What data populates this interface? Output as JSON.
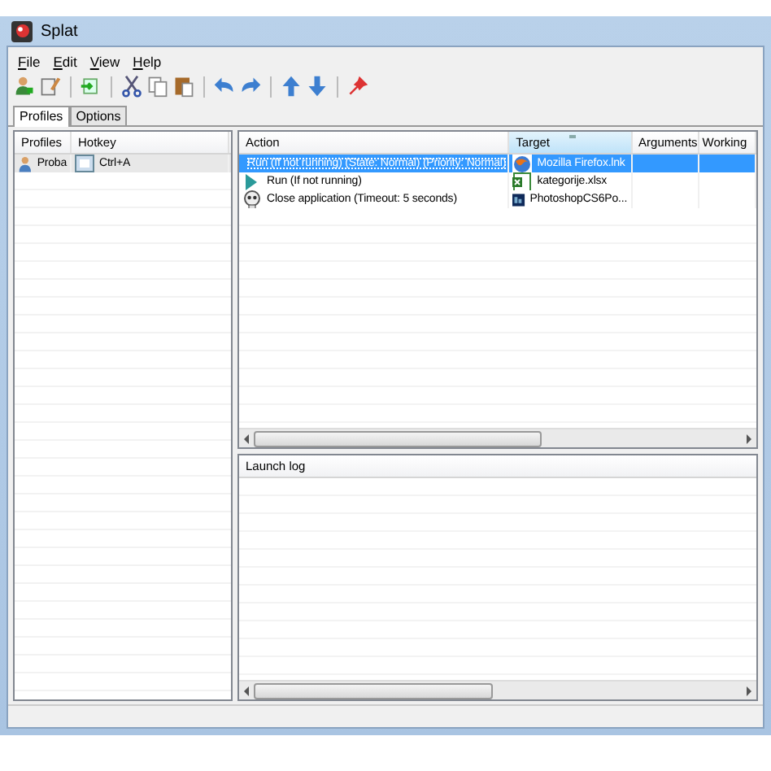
{
  "window": {
    "title": "Splat"
  },
  "menu": [
    {
      "label": "File"
    },
    {
      "label": "Edit"
    },
    {
      "label": "View"
    },
    {
      "label": "Help"
    }
  ],
  "toolbar": [
    {
      "kind": "user"
    },
    {
      "kind": "edit"
    },
    {
      "kind": "sep"
    },
    {
      "kind": "import"
    },
    {
      "kind": "sep"
    },
    {
      "kind": "cut"
    },
    {
      "kind": "copy"
    },
    {
      "kind": "paste"
    },
    {
      "kind": "sep"
    },
    {
      "kind": "undo"
    },
    {
      "kind": "redo"
    },
    {
      "kind": "sep"
    },
    {
      "kind": "up"
    },
    {
      "kind": "down"
    },
    {
      "kind": "sep"
    },
    {
      "kind": "pin"
    }
  ],
  "tabs": [
    {
      "label": "Profiles",
      "selected": true
    },
    {
      "label": "Options",
      "selected": false
    }
  ],
  "profiles": {
    "columns": [
      "Profiles",
      "Hotkey"
    ],
    "rows": [
      {
        "name": "Proba",
        "hotkey": "Ctrl+A",
        "selected": true
      }
    ]
  },
  "actions": {
    "columns": [
      {
        "label": "Action",
        "sorted": false
      },
      {
        "label": "Target",
        "sorted": true
      },
      {
        "label": "Arguments",
        "sorted": false
      },
      {
        "label": "Working",
        "sorted": false
      }
    ],
    "rows": [
      {
        "kind": "run",
        "action": "Run (If not running) (State: Normal) (Priority: Normal)",
        "target": {
          "kind": "firefox",
          "text": "Mozilla Firefox.lnk"
        },
        "selected": true
      },
      {
        "kind": "run",
        "action": "Run (If not running)",
        "target": {
          "kind": "excel",
          "text": "kategorije.xlsx"
        },
        "selected": false
      },
      {
        "kind": "close",
        "action": "Close application (Timeout: 5 seconds)",
        "target": {
          "kind": "photoshop",
          "text": "PhotoshopCS6Po..."
        },
        "selected": false
      }
    ]
  },
  "launch_log": {
    "title": "Launch log"
  }
}
